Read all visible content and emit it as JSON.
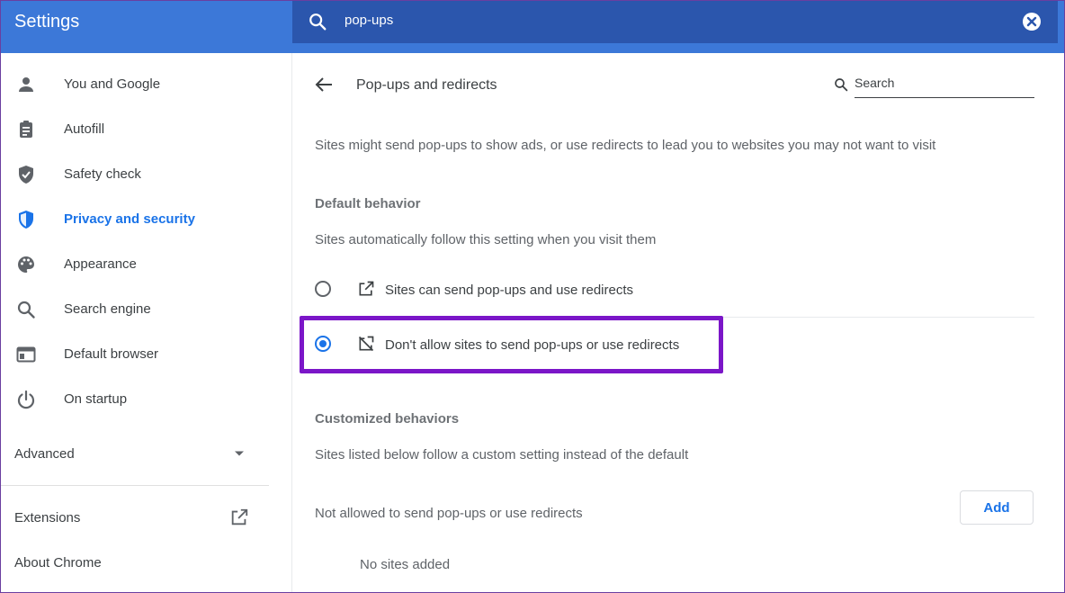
{
  "header": {
    "title": "Settings",
    "search_query": "pop-ups",
    "search_icon": "search-icon",
    "clear_icon": "close-icon"
  },
  "sidebar": {
    "items": [
      {
        "label": "You and Google",
        "icon": "person-icon"
      },
      {
        "label": "Autofill",
        "icon": "clipboard-icon"
      },
      {
        "label": "Safety check",
        "icon": "shield-check-icon"
      },
      {
        "label": "Privacy and security",
        "icon": "shield-icon",
        "active": true
      },
      {
        "label": "Appearance",
        "icon": "palette-icon"
      },
      {
        "label": "Search engine",
        "icon": "search-icon"
      },
      {
        "label": "Default browser",
        "icon": "browser-icon"
      },
      {
        "label": "On startup",
        "icon": "power-icon"
      }
    ],
    "advanced": "Advanced",
    "extensions": "Extensions",
    "about": "About Chrome"
  },
  "main": {
    "title": "Pop-ups and redirects",
    "search_placeholder": "Search",
    "description": "Sites might send pop-ups to show ads, or use redirects to lead you to websites you may not want to visit",
    "default_heading": "Default behavior",
    "default_sub": "Sites automatically follow this setting when you visit them",
    "options": [
      {
        "label": "Sites can send pop-ups and use redirects",
        "selected": false
      },
      {
        "label": "Don't allow sites to send pop-ups or use redirects",
        "selected": true
      }
    ],
    "custom_heading": "Customized behaviors",
    "custom_sub": "Sites listed below follow a custom setting instead of the default",
    "not_allowed_label": "Not allowed to send pop-ups or use redirects",
    "add_button": "Add",
    "no_sites": "No sites added"
  },
  "colors": {
    "header": "#3c78d8",
    "search_bar": "#2b56ad",
    "accent": "#1a73e8",
    "highlight_box": "#7b16c8"
  }
}
